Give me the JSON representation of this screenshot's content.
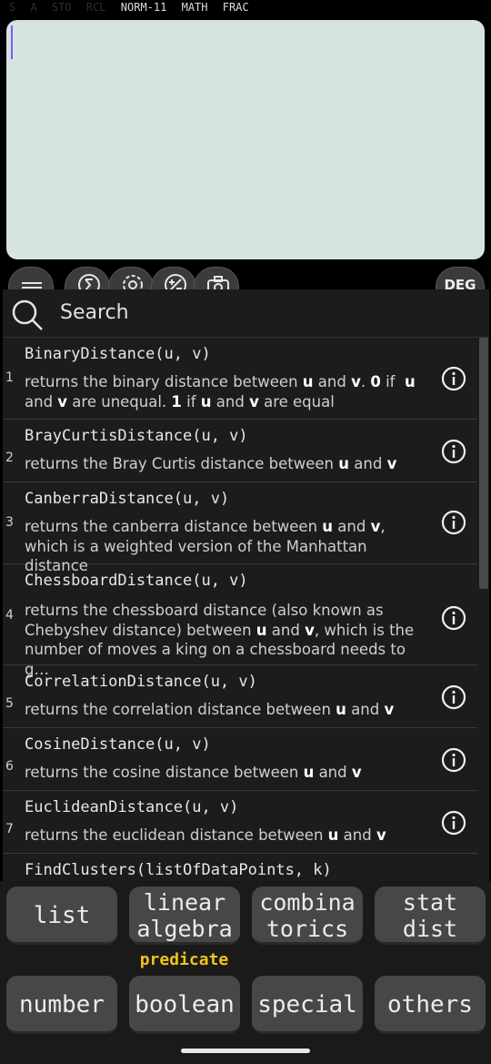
{
  "status": {
    "indicators_dim": [
      "S",
      "A",
      "STO",
      "RCL"
    ],
    "indicators_on": [
      "NORM-11",
      "MATH",
      "FRAC"
    ]
  },
  "toolbar": {
    "angle_mode": "DEG",
    "icons": [
      "menu-icon",
      "sigma-icon",
      "settings-icon",
      "plus-minus-icon",
      "camera-icon"
    ]
  },
  "search": {
    "placeholder": "Search"
  },
  "functions": [
    {
      "index": "1",
      "signature": "BinaryDistance(u, v)",
      "description": "returns the binary distance between u and v. 0 if u and v are unequal. 1 if u and v are equal"
    },
    {
      "index": "2",
      "signature": "BrayCurtisDistance(u, v)",
      "description": "returns the Bray Curtis distance between u and v"
    },
    {
      "index": "3",
      "signature": "CanberraDistance(u, v)",
      "description": "returns the canberra distance between u and v, which is a weighted version of the Manhattan distance"
    },
    {
      "index": "4",
      "signature": "ChessboardDistance(u, v)",
      "description": "returns the chessboard distance (also known as Chebyshev distance) between u and v, which is the number of moves a king on a chessboard needs to g…"
    },
    {
      "index": "5",
      "signature": "CorrelationDistance(u, v)",
      "description": "returns the correlation distance between u and v"
    },
    {
      "index": "6",
      "signature": "CosineDistance(u, v)",
      "description": "returns the cosine distance between u and v"
    },
    {
      "index": "7",
      "signature": "EuclideanDistance(u, v)",
      "description": "returns the euclidean distance between u and v"
    },
    {
      "index": "",
      "signature": "FindClusters(listOfDataPoints, k)",
      "description": ""
    }
  ],
  "keys": {
    "row1": [
      {
        "lines": [
          "list"
        ]
      },
      {
        "lines": [
          "linear",
          "algebra"
        ]
      },
      {
        "lines": [
          "combina",
          "torics"
        ]
      },
      {
        "lines": [
          "stat",
          "dist"
        ]
      }
    ],
    "shift_label": "predicate",
    "row2": [
      {
        "lines": [
          "number"
        ]
      },
      {
        "lines": [
          "boolean"
        ]
      },
      {
        "lines": [
          "special"
        ]
      },
      {
        "lines": [
          "others"
        ]
      }
    ]
  },
  "colors": {
    "display_bg": "#d6e3e1",
    "cursor": "#7a5cff",
    "shift_label": "#f2c318",
    "key_bg": "#474747",
    "panel_bg": "#1c1c1c"
  }
}
